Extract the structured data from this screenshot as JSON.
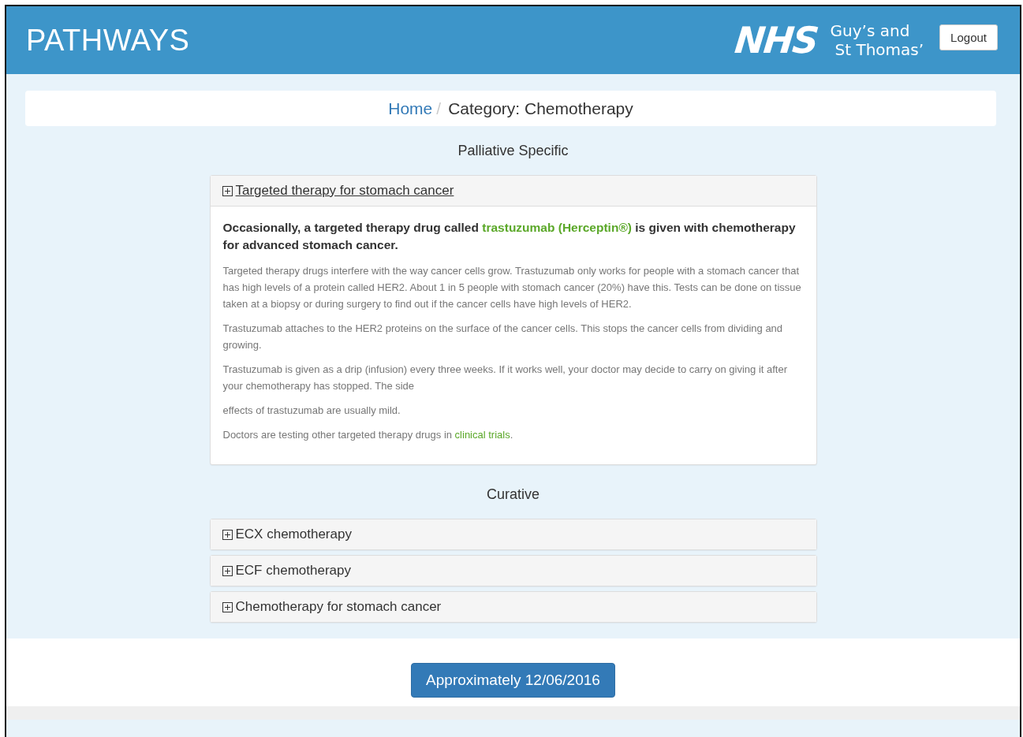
{
  "header": {
    "title": "PATHWAYS",
    "logo": {
      "mark": "NHS",
      "org_line_1": "Guy’s and",
      "org_line_2": "St Thomas’"
    },
    "logout": "Logout"
  },
  "breadcrumb": [
    {
      "label": "Home",
      "kind": "link"
    },
    {
      "label": "/",
      "kind": "separator"
    },
    {
      "label": "Category: Chemotherapy",
      "kind": "current"
    }
  ],
  "sections": [
    {
      "title": "Palliative Specific",
      "panels": [
        {
          "title": "Targeted therapy for stomach cancer",
          "expanded": true,
          "lead": [
            {
              "kind": "text",
              "text": "Occasionally, a targeted therapy drug called "
            },
            {
              "kind": "link",
              "text": "trastuzumab (Herceptin®)"
            },
            {
              "kind": "text",
              "text": " is given with chemotherapy for advanced stomach cancer."
            }
          ],
          "paragraphs": [
            [
              {
                "kind": "text",
                "text": "Targeted therapy drugs interfere with the way cancer cells grow. Trastuzumab only works for people with a stomach cancer that has high levels of a protein called HER2. About 1 in 5 people with stomach cancer (20%) have this. Tests can be done on tissue taken at a biopsy or during surgery to find out if the cancer cells have high levels of HER2."
              }
            ],
            [
              {
                "kind": "text",
                "text": "Trastuzumab attaches to the HER2 proteins on the surface of the cancer cells. This stops the cancer cells from dividing and growing."
              }
            ],
            [
              {
                "kind": "text",
                "text": "Trastuzumab is given as a drip (infusion) every three weeks. If it works well, your doctor may decide to carry on giving it after your chemotherapy has stopped. The side"
              }
            ],
            [
              {
                "kind": "text",
                "text": "effects of trastuzumab are usually mild."
              }
            ],
            [
              {
                "kind": "text",
                "text": "Doctors are testing other targeted therapy drugs in "
              },
              {
                "kind": "link",
                "text": "clinical trials"
              },
              {
                "kind": "text",
                "text": "."
              }
            ]
          ]
        }
      ]
    },
    {
      "title": "Curative",
      "panels": [
        {
          "title": "ECX chemotherapy",
          "expanded": false
        },
        {
          "title": "ECF chemotherapy",
          "expanded": false
        },
        {
          "title": "Chemotherapy for stomach cancer",
          "expanded": false
        }
      ]
    }
  ],
  "footer": {
    "date_button": "Approximately 12/06/2016"
  }
}
